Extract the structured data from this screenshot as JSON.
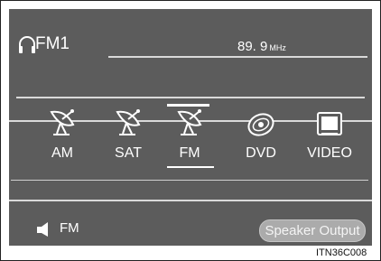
{
  "header": {
    "band": "FM1",
    "frequency": "89. 9",
    "frequency_unit": "MHz"
  },
  "sources": [
    {
      "label": "AM",
      "icon": "satellite-dish-icon"
    },
    {
      "label": "SAT",
      "icon": "satellite-dish-icon"
    },
    {
      "label": "FM",
      "icon": "satellite-dish-icon",
      "selected": true
    },
    {
      "label": "DVD",
      "icon": "disc-icon"
    },
    {
      "label": "VIDEO",
      "icon": "screen-icon"
    }
  ],
  "footer": {
    "source": "FM",
    "speaker_output_label": "Speaker Output"
  },
  "figure_code": "ITN36C008",
  "colors": {
    "screen_bg": "#5c5c5c",
    "text": "#ffffff",
    "button_bg": "#ababab"
  }
}
